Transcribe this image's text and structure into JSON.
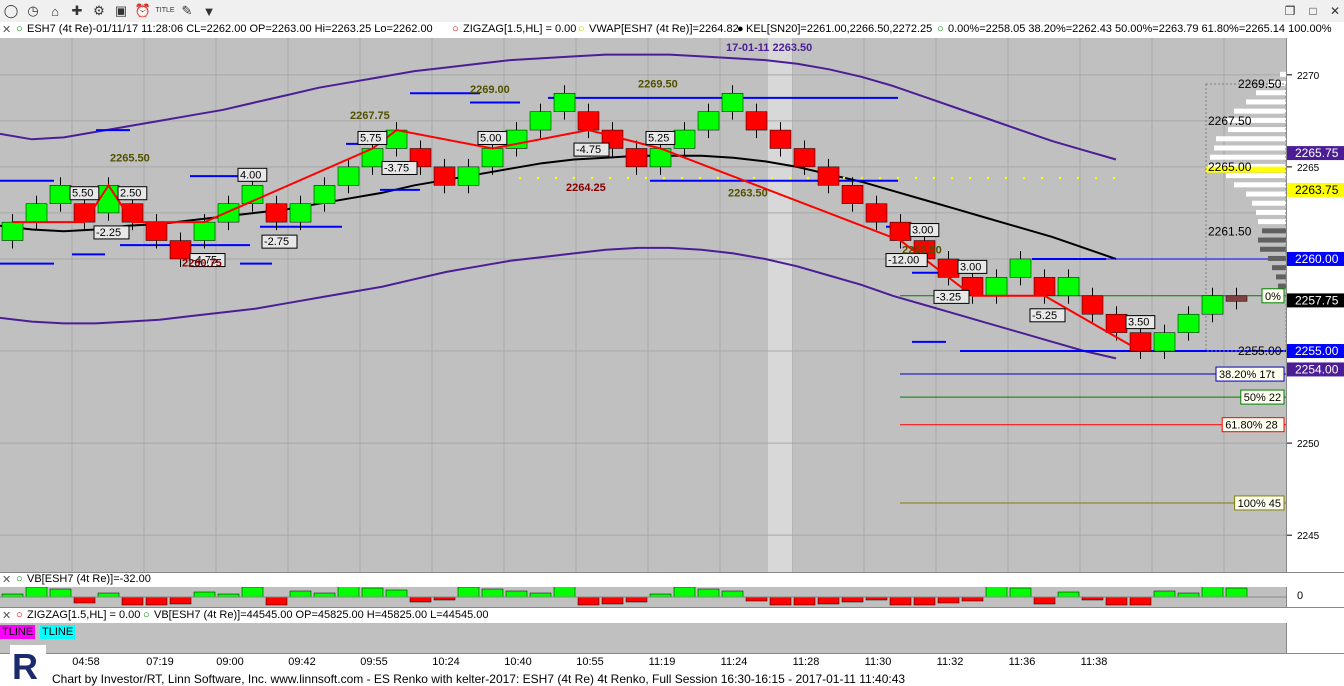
{
  "toolbar": {
    "icons": [
      "back-icon",
      "clock-icon",
      "home-icon",
      "crosshair-icon",
      "gear-icon",
      "window-icon",
      "alarm-icon",
      "title-icon",
      "eraser-icon"
    ],
    "title_icon_text": "TITLE"
  },
  "infobar": {
    "symbol": "ESH7 (4t Re)-01/11/17 11:28:06 CL=2262.00 OP=2263.00 Hi=2263.25 Lo=2262.00",
    "zigzag": "ZIGZAG[1.5,HL] = 0.00",
    "vwap": "VWAP[ESH7 (4t Re)]=2264.82",
    "kel": "KEL[SN20]=2261.00,2266.50,2272.25",
    "fib": "0.00%=2258.05 38.20%=2262.43 50.00%=2263.79 61.80%=2265.14 100.00%"
  },
  "vb_bar": {
    "label": "VB[ESH7 (4t Re)]=-32.00"
  },
  "zz_bar": {
    "zigzag": "ZIGZAG[1.5,HL] = 0.00",
    "vb": "VB[ESH7 (4t Re)]=44545.00 OP=45825.00 H=45825.00 L=44545.00"
  },
  "tlines": [
    "TLINE",
    "TLINE"
  ],
  "footer": {
    "text": "Chart by Investor/RT, Linn Software, Inc. www.linnsoft.com - ES Renko with kelter-2017: ESH7 (4t Re) 4t Renko, Full Session 16:30-16:15 - 2017-01-11 11:40:43"
  },
  "colors": {
    "up": "#00ff00",
    "down": "#ff0000",
    "zigzag": "#ff0000",
    "kelter": "#4b1e96",
    "vwap": "#000000",
    "level": "#0000ff",
    "background": "#c0c0c0"
  },
  "chart_data": {
    "type": "candlestick",
    "title": "",
    "ylim": [
      2243,
      2272
    ],
    "y_ticks": [
      2245,
      2250,
      2255,
      2260,
      2265,
      2270
    ],
    "time_labels": [
      "04:58",
      "07:19",
      "09:00",
      "09:42",
      "09:55",
      "10:24",
      "10:40",
      "10:55",
      "11:19",
      "11:24",
      "11:28",
      "11:30",
      "11:32",
      "11:36",
      "11:38"
    ],
    "bricks": [
      {
        "o": 2261.0,
        "c": 2262.0
      },
      {
        "o": 2262.0,
        "c": 2263.0
      },
      {
        "o": 2263.0,
        "c": 2264.0
      },
      {
        "o": 2263.0,
        "c": 2262.0
      },
      {
        "o": 2262.5,
        "c": 2264.0
      },
      {
        "o": 2263.0,
        "c": 2262.0
      },
      {
        "o": 2262.0,
        "c": 2261.0
      },
      {
        "o": 2261.0,
        "c": 2260.0
      },
      {
        "o": 2261.0,
        "c": 2262.0
      },
      {
        "o": 2262.0,
        "c": 2263.0
      },
      {
        "o": 2263.0,
        "c": 2264.0
      },
      {
        "o": 2263.0,
        "c": 2262.0
      },
      {
        "o": 2262.0,
        "c": 2263.0
      },
      {
        "o": 2263.0,
        "c": 2264.0
      },
      {
        "o": 2264.0,
        "c": 2265.0
      },
      {
        "o": 2265.0,
        "c": 2266.0
      },
      {
        "o": 2266.0,
        "c": 2267.0
      },
      {
        "o": 2266.0,
        "c": 2265.0
      },
      {
        "o": 2265.0,
        "c": 2264.0
      },
      {
        "o": 2264.0,
        "c": 2265.0
      },
      {
        "o": 2265.0,
        "c": 2266.0
      },
      {
        "o": 2266.0,
        "c": 2267.0
      },
      {
        "o": 2267.0,
        "c": 2268.0
      },
      {
        "o": 2268.0,
        "c": 2269.0
      },
      {
        "o": 2268.0,
        "c": 2267.0
      },
      {
        "o": 2267.0,
        "c": 2266.0
      },
      {
        "o": 2266.0,
        "c": 2265.0
      },
      {
        "o": 2265.0,
        "c": 2266.0
      },
      {
        "o": 2266.0,
        "c": 2267.0
      },
      {
        "o": 2267.0,
        "c": 2268.0
      },
      {
        "o": 2268.0,
        "c": 2269.0
      },
      {
        "o": 2268.0,
        "c": 2267.0
      },
      {
        "o": 2267.0,
        "c": 2266.0
      },
      {
        "o": 2266.0,
        "c": 2265.0
      },
      {
        "o": 2265.0,
        "c": 2264.0
      },
      {
        "o": 2264.0,
        "c": 2263.0
      },
      {
        "o": 2263.0,
        "c": 2262.0
      },
      {
        "o": 2262.0,
        "c": 2261.0
      },
      {
        "o": 2261.0,
        "c": 2260.0
      },
      {
        "o": 2260.0,
        "c": 2259.0
      },
      {
        "o": 2259.0,
        "c": 2258.0
      },
      {
        "o": 2258.0,
        "c": 2259.0
      },
      {
        "o": 2259.0,
        "c": 2260.0
      },
      {
        "o": 2259.0,
        "c": 2258.0
      },
      {
        "o": 2258.0,
        "c": 2259.0
      },
      {
        "o": 2258.0,
        "c": 2257.0
      },
      {
        "o": 2257.0,
        "c": 2256.0
      },
      {
        "o": 2256.0,
        "c": 2255.0
      },
      {
        "o": 2255.0,
        "c": 2256.0
      },
      {
        "o": 2256.0,
        "c": 2257.0
      },
      {
        "o": 2257.0,
        "c": 2258.0
      },
      {
        "o": 2258.0,
        "c": 2258.0
      }
    ],
    "zigzag_labels": [
      {
        "text": "5.50",
        "brick": 3
      },
      {
        "text": "-2.25",
        "brick": 4
      },
      {
        "text": "2.50",
        "brick": 5
      },
      {
        "text": "4.00",
        "brick": 10
      },
      {
        "text": "-4.75",
        "brick": 8
      },
      {
        "text": "-2.75",
        "brick": 11
      },
      {
        "text": "5.75",
        "brick": 15
      },
      {
        "text": "-3.75",
        "brick": 16
      },
      {
        "text": "5.00",
        "brick": 20
      },
      {
        "text": "-4.75",
        "brick": 24
      },
      {
        "text": "5.25",
        "brick": 27
      },
      {
        "text": "3.00",
        "brick": 38
      },
      {
        "text": "-12.00",
        "brick": 37
      },
      {
        "text": "3.00",
        "brick": 40
      },
      {
        "text": "-3.25",
        "brick": 39
      },
      {
        "text": "-5.25",
        "brick": 43
      },
      {
        "text": "3.50",
        "brick": 47
      }
    ],
    "swing_labels": [
      "2265.50",
      "2260.75",
      "2267.75",
      "2269.00",
      "2264.25",
      "2269.50",
      "2263.50",
      "2260.50",
      "17-01-11  2263.50"
    ],
    "volume_profile_prices": [
      "2269.50",
      "2267.50",
      "2265.00",
      "2261.50",
      "2255.00"
    ],
    "right_badges": [
      {
        "text": "2265.75",
        "value": 2265.75
      },
      {
        "text": "2263.75",
        "value": 2263.75
      },
      {
        "text": "2260.00",
        "value": 2260.0
      },
      {
        "text": "0%",
        "value": 2258.0
      },
      {
        "text": "2257.75",
        "value": 2257.75
      },
      {
        "text": "2255.00",
        "value": 2255.0
      },
      {
        "text": "2254.00",
        "value": 2254.0
      }
    ],
    "fib_levels": [
      {
        "text": "38.20% 17t",
        "value": 2253.75
      },
      {
        "text": "50% 22",
        "value": 2252.5
      },
      {
        "text": "61.80% 28",
        "value": 2251.0
      },
      {
        "text": "100% 45",
        "value": 2246.75
      }
    ],
    "vb_axis_label": "0"
  }
}
